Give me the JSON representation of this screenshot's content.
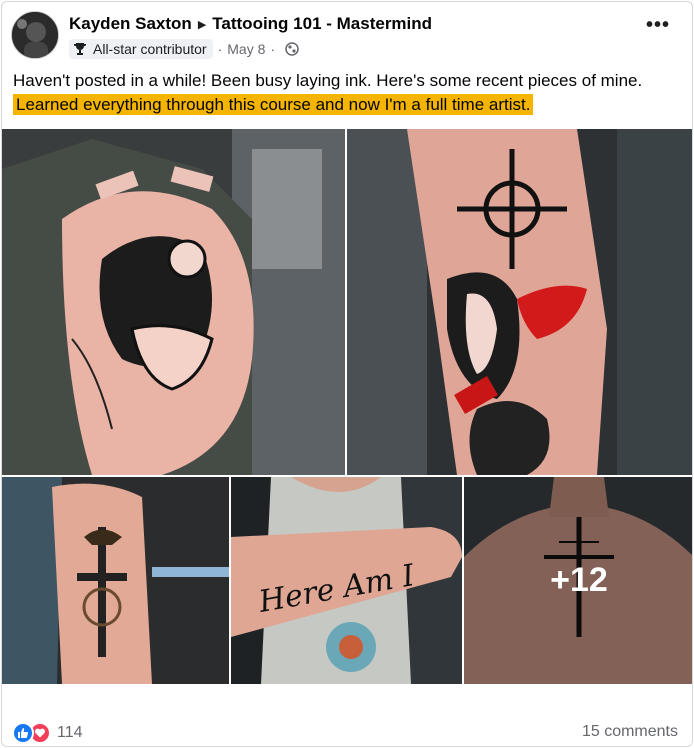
{
  "post": {
    "author": "Kayden Saxton",
    "group": "Tattooing 101 - Mastermind",
    "badge": "All-star contributor",
    "date": "May 8",
    "text_plain": "Haven't posted in a while! Been busy laying ink. Here's some recent pieces of mine.",
    "text_highlight": "Learned everything through this course and now I'm a full time artist.",
    "more_photos": "+12"
  },
  "footer": {
    "reaction_count": "114",
    "comments": "15 comments"
  },
  "icons": {
    "options": "more-options-icon",
    "privacy": "globe-icon",
    "badge": "trophy-icon",
    "like": "like-icon",
    "love": "love-icon"
  },
  "colors": {
    "highlight": "#f4b400",
    "like": "#1877f2",
    "love": "#f33e58",
    "secondary_text": "#65676b"
  }
}
